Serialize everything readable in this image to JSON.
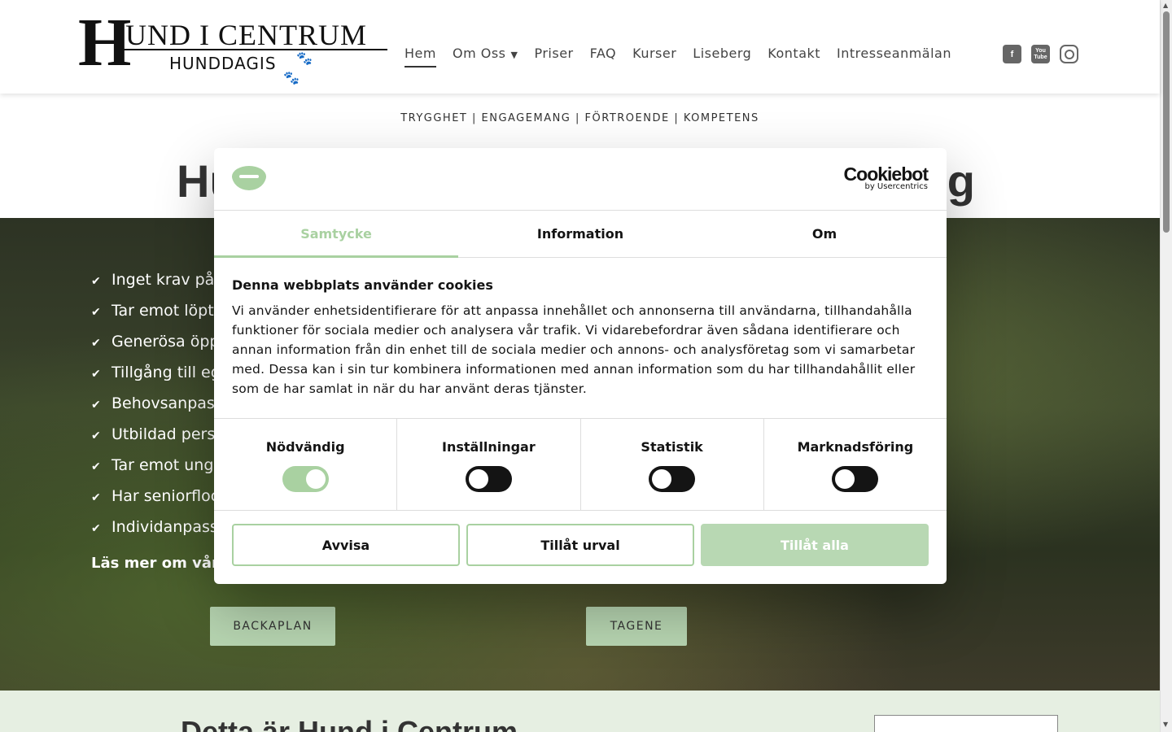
{
  "header": {
    "logo": {
      "big_letter": "H",
      "top_text": "UND I CENTRUM",
      "bottom_text": "HUNDDAGIS"
    },
    "nav": [
      {
        "label": "Hem",
        "active": true
      },
      {
        "label": "Om Oss",
        "has_dropdown": true
      },
      {
        "label": "Priser"
      },
      {
        "label": "FAQ"
      },
      {
        "label": "Kurser"
      },
      {
        "label": "Liseberg"
      },
      {
        "label": "Kontakt"
      },
      {
        "label": "Intresseanmälan"
      }
    ],
    "social": [
      {
        "icon": "facebook-icon"
      },
      {
        "icon": "youtube-icon",
        "text": "You Tube"
      },
      {
        "icon": "instagram-icon"
      }
    ]
  },
  "tagline": "TRYGGHET | ENGAGEMANG | FÖRTROENDE | KOMPETENS",
  "hero_title_left": "Hu",
  "hero_title_right": "rg",
  "hero": {
    "list": [
      "Inget krav på h",
      "Tar emot löptik",
      "Generösa öpp",
      "Tillgång till eg",
      "Behovsanpass",
      "Utbildad perso",
      "Tar emot ungh",
      "Har seniorfloc",
      "Individanpass"
    ],
    "read_more": "Läs mer om våra",
    "buttons": [
      "BACKAPLAN",
      "TAGENE"
    ]
  },
  "section": {
    "title": "Detta är Hund i Centrum"
  },
  "cookie_dialog": {
    "brand": "Cookiebot",
    "brand_sub": "by Usercentrics",
    "tabs": [
      {
        "label": "Samtycke",
        "active": true
      },
      {
        "label": "Information"
      },
      {
        "label": "Om"
      }
    ],
    "heading": "Denna webbplats använder cookies",
    "body": "Vi använder enhetsidentifierare för att anpassa innehållet och annonserna till användarna, tillhandahålla funktioner för sociala medier och analysera vår trafik. Vi vidarebefordrar även sådana identifierare och annan information från din enhet till de sociala medier och annons- och analysföretag som vi samarbetar med. Dessa kan i sin tur kombinera informationen med annan information som du har tillhandahållit eller som de har samlat in när du har använt deras tjänster.",
    "toggles": [
      {
        "label": "Nödvändig",
        "on": true
      },
      {
        "label": "Inställningar",
        "on": false
      },
      {
        "label": "Statistik",
        "on": false
      },
      {
        "label": "Marknadsföring",
        "on": false
      }
    ],
    "buttons": {
      "reject": "Avvisa",
      "allow_selection": "Tillåt urval",
      "allow_all": "Tillåt alla"
    }
  },
  "colors": {
    "accent_green": "#a9d1a1",
    "band_green": "#e6efe2",
    "text_dark": "#141414"
  }
}
